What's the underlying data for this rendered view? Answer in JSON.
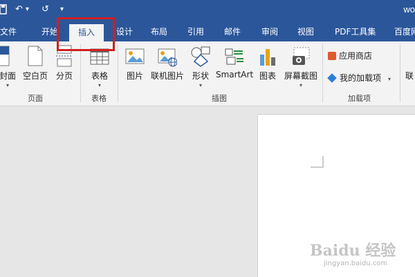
{
  "window": {
    "title": "wo"
  },
  "qat": {
    "undo": "↶",
    "undo_dd": "▾",
    "redo": "↺",
    "customize": "▾"
  },
  "tabs": [
    {
      "label": "文件"
    },
    {
      "label": "开始"
    },
    {
      "label": "插入"
    },
    {
      "label": "设计"
    },
    {
      "label": "布局"
    },
    {
      "label": "引用"
    },
    {
      "label": "邮件"
    },
    {
      "label": "审阅"
    },
    {
      "label": "视图"
    },
    {
      "label": "PDF工具集"
    },
    {
      "label": "百度网"
    }
  ],
  "active_tab": "插入",
  "ribbon": {
    "pages": {
      "cover": "封面",
      "blank": "空白页",
      "pagebreak": "分页",
      "group": "页面"
    },
    "tables": {
      "table": "表格",
      "group": "表格"
    },
    "illustrations": {
      "picture": "图片",
      "online_picture": "联机图片",
      "shapes": "形状",
      "smartart": "SmartArt",
      "chart": "图表",
      "screenshot": "屏幕截图",
      "group": "插图"
    },
    "addins": {
      "store": "应用商店",
      "my_addins": "我的加载项",
      "group": "加载项"
    },
    "cut_label": "联"
  },
  "watermark": {
    "brand": "Baidu 经验",
    "url": "jingyan.baidu.com"
  },
  "colors": {
    "accent": "#2b579a",
    "highlight": "#d01f1f",
    "ribbon_bg": "#f3f3f3",
    "canvas_bg": "#e6e6e6"
  }
}
